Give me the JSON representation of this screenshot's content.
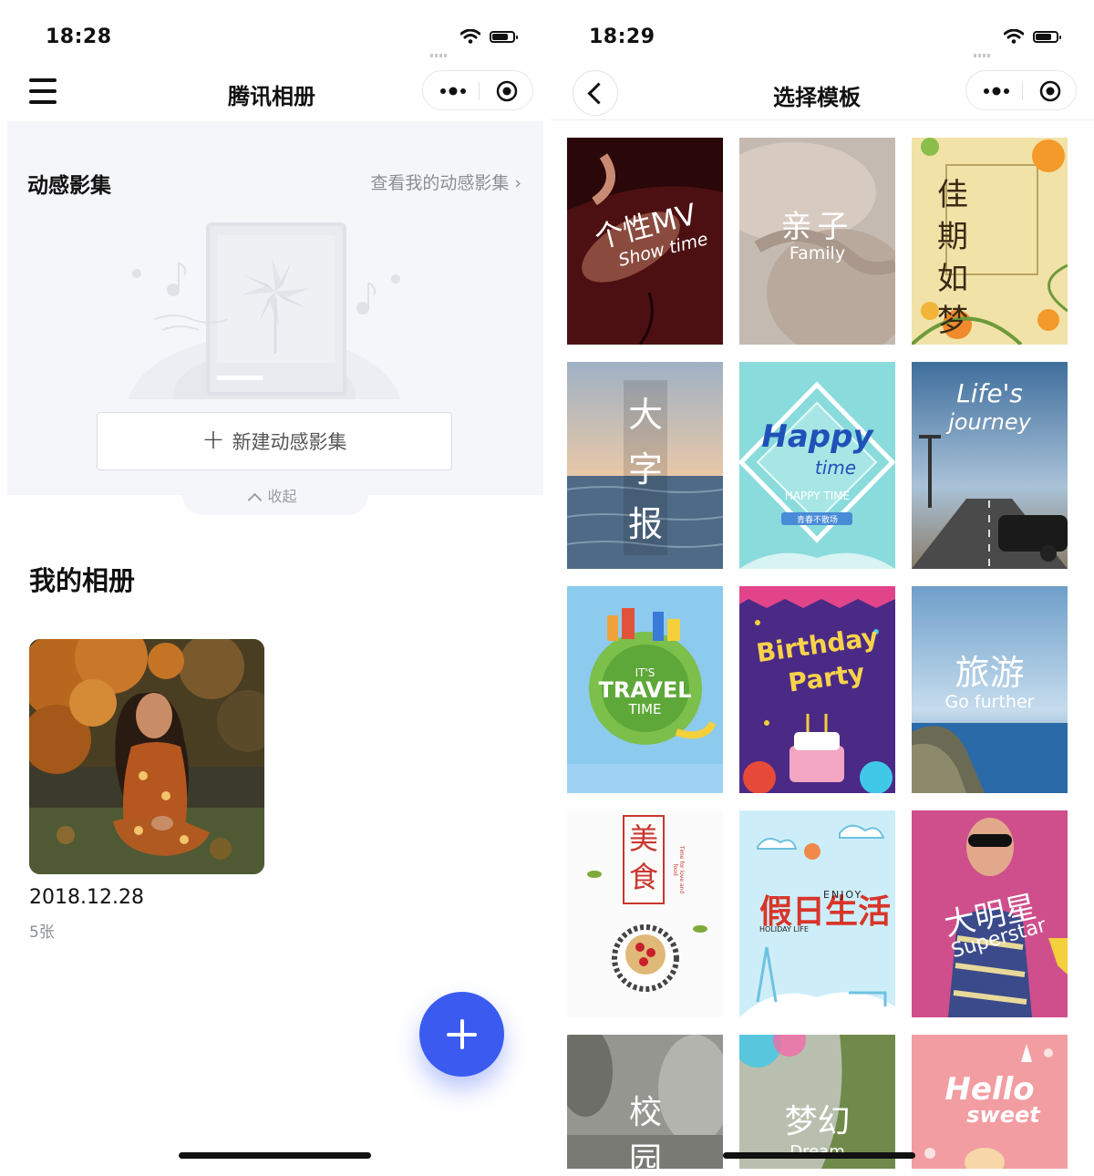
{
  "left": {
    "status_time": "18:28",
    "title": "腾讯相册",
    "dynamic": {
      "title": "动感影集",
      "link": "查看我的动感影集 ›",
      "new_button": "新建动感影集",
      "collapse": "收起"
    },
    "albums": {
      "title": "我的相册",
      "items": [
        {
          "date": "2018.12.28",
          "count": "5张"
        }
      ]
    }
  },
  "right": {
    "status_time": "18:29",
    "title": "选择模板",
    "templates": [
      {
        "main": "个性MV",
        "sub": "Show time"
      },
      {
        "main": "亲子",
        "sub": "Family"
      },
      {
        "main": "佳期如梦",
        "sub": ""
      },
      {
        "main": "大字报",
        "sub": ""
      },
      {
        "main": "Happy",
        "sub": "time",
        "extra": "HAPPY TIME",
        "badge": "青春不散场"
      },
      {
        "main": "Life's",
        "sub": "journey"
      },
      {
        "main": "TRAVEL",
        "sub": "TIME",
        "extra": "IT'S"
      },
      {
        "main": "Birthday",
        "sub": "Party"
      },
      {
        "main": "旅游",
        "sub": "Go further"
      },
      {
        "main": "美食",
        "sub": "Time for love and food"
      },
      {
        "main": "假日生活",
        "sub": "HOLIDAY LIFE",
        "extra": "ENJOY"
      },
      {
        "main": "大明星",
        "sub": "Superstar"
      },
      {
        "main": "校园",
        "sub": ""
      },
      {
        "main": "梦幻",
        "sub": "Dream"
      },
      {
        "main": "Hello",
        "sub": "sweet"
      }
    ]
  },
  "colors": {
    "accent": "#3b5bf0",
    "panel_bg": "#f5f6f9"
  },
  "icons": [
    "menu-icon",
    "more-dots-icon",
    "record-target-icon",
    "back-chevron-icon",
    "plus-icon",
    "chevron-up-icon",
    "wifi-icon",
    "battery-icon",
    "signal-icon"
  ]
}
